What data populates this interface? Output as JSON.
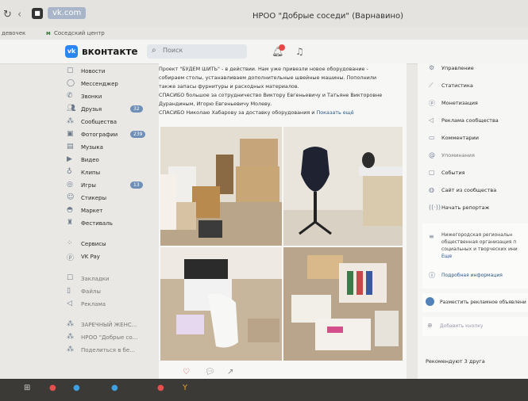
{
  "browser": {
    "url": "vk.com",
    "page_title": "НРОО \"Добрые соседи\" (Варнавино)",
    "bookmarks": [
      "девочек",
      "Соседский центр"
    ]
  },
  "vk": {
    "brand": "вконтакте",
    "search_placeholder": "Поиск"
  },
  "sidebar": {
    "items": [
      {
        "label": "Новости",
        "icon": "news-icon"
      },
      {
        "label": "Мессенджер",
        "icon": "messenger-icon"
      },
      {
        "label": "Звонки",
        "icon": "calls-icon"
      },
      {
        "label": "Друзья",
        "icon": "friends-icon",
        "badge": "32"
      },
      {
        "label": "Сообщества",
        "icon": "communities-icon"
      },
      {
        "label": "Фотографии",
        "icon": "photos-icon",
        "badge": "239"
      },
      {
        "label": "Музыка",
        "icon": "music-icon"
      },
      {
        "label": "Видео",
        "icon": "video-icon"
      },
      {
        "label": "Клипы",
        "icon": "clips-icon"
      },
      {
        "label": "Игры",
        "icon": "games-icon",
        "badge": "13"
      },
      {
        "label": "Стикеры",
        "icon": "stickers-icon"
      },
      {
        "label": "Маркет",
        "icon": "market-icon"
      },
      {
        "label": "Фестиваль",
        "icon": "festival-icon"
      },
      {
        "label": "Сервисы",
        "icon": "services-icon"
      },
      {
        "label": "VK Pay",
        "icon": "vkpay-icon"
      },
      {
        "label": "Закладки",
        "icon": "bookmarks-icon"
      },
      {
        "label": "Файлы",
        "icon": "files-icon"
      },
      {
        "label": "Реклама",
        "icon": "ads-icon"
      },
      {
        "label": "ЗАРЕЧНЫЙ ЖЕНС...",
        "icon": "group-icon"
      },
      {
        "label": "НРОО \"Добрые со...",
        "icon": "group-icon"
      },
      {
        "label": "Поделиться в бе...",
        "icon": "group-icon"
      }
    ]
  },
  "post": {
    "lines": [
      "Проект \"БУДЕМ ШИТЬ\" - в действии. Нам уже привезли новое оборудование -",
      "собираем столы, устанавливаем дополнительные швейные машины. Пополнили",
      "также запасы фурнитуры и расходных материалов.",
      "СПАСИБО большое за сотрудничество Виктору Евгеньевичу и Татьяне Викторовне",
      "Дурандиным, Игорю Евгеньевичу Молеву.",
      "СПАСИБО Николаю Хабарову за доставку оборудования и"
    ],
    "more_label": "Показать ещё",
    "photos": [
      "photo-boxes",
      "photo-mannequin",
      "photo-kettle",
      "photo-supplies"
    ]
  },
  "right_panel": {
    "menu": [
      {
        "label": "Управление",
        "icon": "manage-icon"
      },
      {
        "label": "Статистика",
        "icon": "stats-icon"
      },
      {
        "label": "Монетизация",
        "icon": "monetization-icon"
      },
      {
        "label": "Реклама сообщества",
        "icon": "promo-icon"
      },
      {
        "label": "Комментарии",
        "icon": "comments-icon"
      },
      {
        "label": "Упоминания",
        "icon": "mentions-icon"
      },
      {
        "label": "События",
        "icon": "events-icon"
      },
      {
        "label": "Сайт из сообщества",
        "icon": "site-icon"
      },
      {
        "label": "Начать репортаж",
        "icon": "broadcast-icon"
      }
    ],
    "about_lines": [
      "Нижегородская региональн",
      "общественная организация п",
      "социальных и творческих ини",
      "Еще"
    ],
    "more_info": "Подробная информация",
    "ad_label": "Разместить рекламное объявлени",
    "add_button": "Добавить кнопку",
    "recommend": "Рекомендуют 3 друга"
  },
  "colors": {
    "vk_blue": "#2787f5",
    "badge_red": "#e64646",
    "link": "#2a5885"
  }
}
